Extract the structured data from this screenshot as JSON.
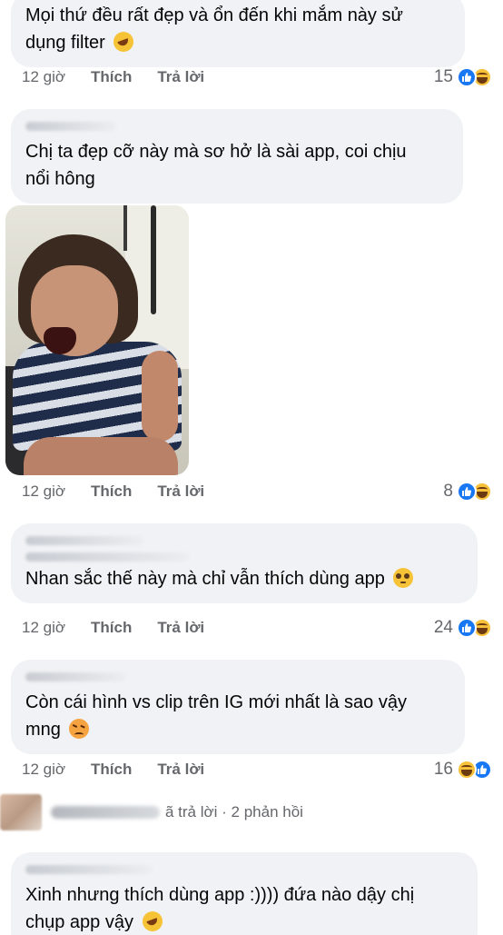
{
  "comments": [
    {
      "text_line1": "Mọi thứ đều rất đẹp và ổn đến khi mắm này sử",
      "text_line2": "dụng filter",
      "emoji": "rofl-emoji",
      "time": "12 giờ",
      "like_label": "Thích",
      "reply_label": "Trả lời",
      "reaction_count": "15",
      "reactions": [
        "like",
        "haha"
      ]
    },
    {
      "text_line1": "Chị ta đẹp cỡ này mà sơ hở là sài app, coi chịu",
      "text_line2": "nổi hông",
      "time": "12 giờ",
      "like_label": "Thích",
      "reply_label": "Trả lời",
      "reaction_count": "8",
      "reactions": [
        "like",
        "haha"
      ]
    },
    {
      "text_line1": "Nhan sắc thế này mà chỉ vẫn thích dùng app",
      "emoji": "pleading-emoji",
      "time": "12 giờ",
      "like_label": "Thích",
      "reply_label": "Trả lời",
      "reaction_count": "24",
      "reactions": [
        "like",
        "haha"
      ]
    },
    {
      "text_line1": "Còn cái hình vs clip trên IG mới nhất là sao vậy",
      "text_line2": "mng",
      "emoji": "angry-emoji",
      "time": "12 giờ",
      "like_label": "Thích",
      "reply_label": "Trả lời",
      "reaction_count": "16",
      "reactions": [
        "haha",
        "like"
      ]
    },
    {
      "text_line1": "Xinh nhưng thích dùng app :)))) đứa nào dậy chị",
      "text_line2": "chụp app vậy",
      "emoji": "rofl-emoji"
    }
  ],
  "reply_summary": {
    "text": "ã trả lời · 2 phản hồi"
  }
}
